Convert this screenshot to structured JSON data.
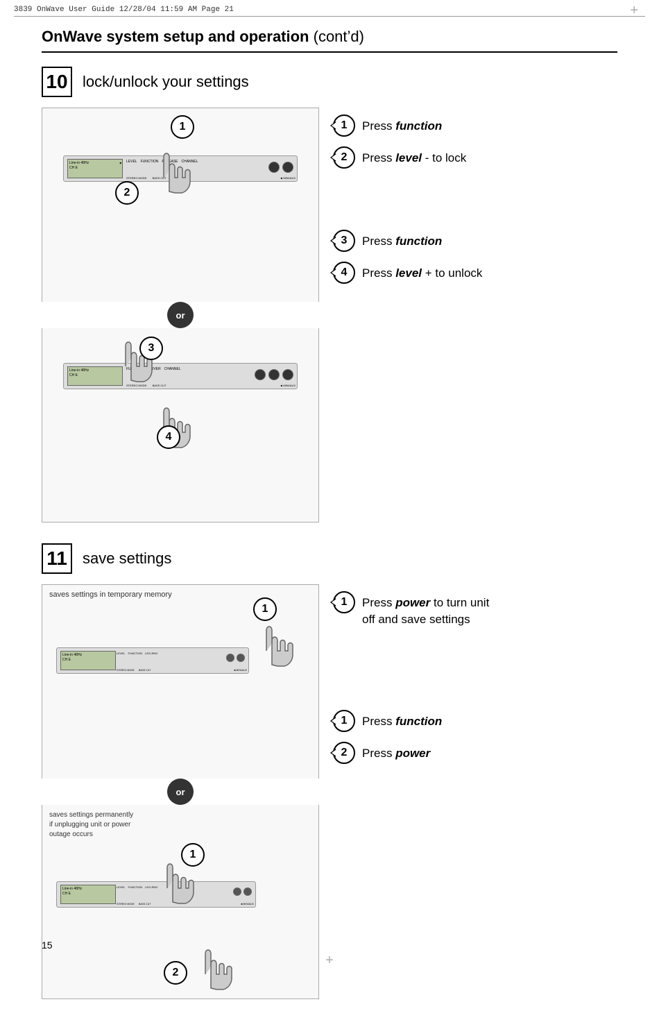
{
  "header": {
    "text": "3839 OnWave User Guide   12/28/04   11:59 AM   Page 21"
  },
  "page_title": {
    "bold": "OnWave system setup and operation",
    "normal": " (cont’d)"
  },
  "section10": {
    "number": "10",
    "title": "lock/unlock your settings",
    "step1_label": "1",
    "step2_label": "2",
    "step3_label": "3",
    "step4_label": "4",
    "or_label": "or",
    "instructions": [
      {
        "num": "1",
        "text": "Press ",
        "italic": "function"
      },
      {
        "num": "2",
        "text": "Press ",
        "italic": "level",
        "suffix": " - to lock"
      },
      {
        "num": "3",
        "text": "Press ",
        "italic": "function"
      },
      {
        "num": "4",
        "text": "Press ",
        "italic": "level",
        "suffix": " + to unlock"
      }
    ],
    "device_label1": "Line-in  48Hz\nCH E",
    "device_label2": "Line-in  48Hz\nCH E"
  },
  "section11": {
    "number": "11",
    "title": "save settings",
    "or_label": "or",
    "box1_label": "saves settings in temporary memory",
    "box2_label": "saves settings permanently\nif unplugging unit or power\noutage occurs",
    "step1_label": "1",
    "step2_label": "2",
    "instructions_top": [
      {
        "num": "1",
        "text": "Press ",
        "italic": "power",
        "suffix": " to turn unit\noff and save settings"
      }
    ],
    "instructions_bottom": [
      {
        "num": "1",
        "text": "Press ",
        "italic": "function"
      },
      {
        "num": "2",
        "text": "Press ",
        "italic": "power"
      }
    ]
  },
  "page_number": "15"
}
